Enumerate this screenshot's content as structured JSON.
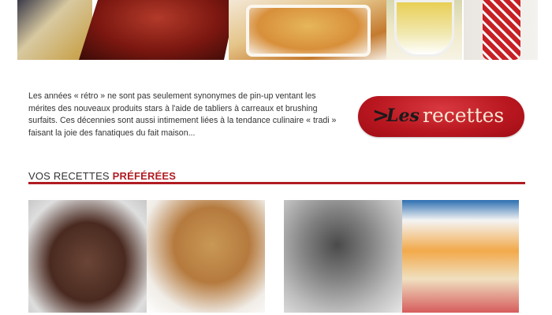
{
  "intro": {
    "text": "Les années « rétro » ne sont pas seulement synonymes de pin-up ventant les mérites des nouveaux produits stars à l'aide de tabliers à carreaux et brushing surfaits. Ces décennies sont aussi intimement liées à la tendance culinaire « tradi » faisant la joie des fanatiques du fait maison..."
  },
  "cta": {
    "arrow": ">",
    "les": "Les",
    "recettes": "recettes"
  },
  "section": {
    "title_prefix": "VOS RECETTES ",
    "title_highlight": "PRÉFÉRÉES"
  },
  "colors": {
    "accent": "#b01c22",
    "text": "#333333"
  }
}
